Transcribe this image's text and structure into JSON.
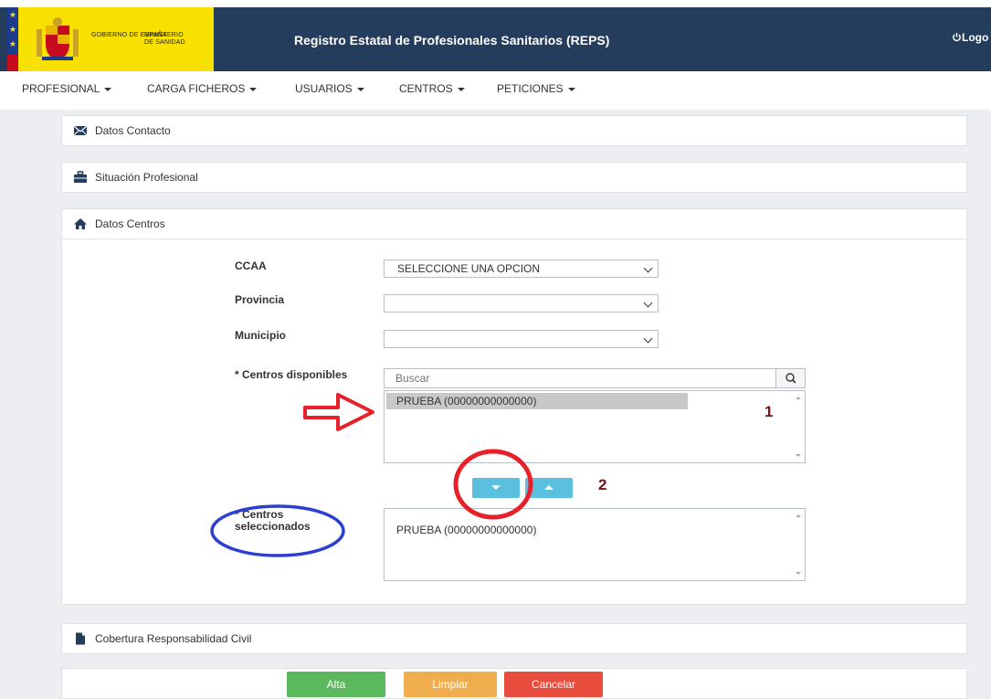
{
  "header": {
    "logo_gobierno": "GOBIERNO DE ESPAÑA",
    "logo_ministerio": "MINISTERIO DE SANIDAD",
    "title": "Registro Estatal de Profesionales Sanitarios (REPS)",
    "logout_label": "Logo"
  },
  "nav": {
    "items": [
      "PROFESIONAL",
      "CARGA FICHEROS",
      "USUARIOS",
      "CENTROS",
      "PETICIONES"
    ]
  },
  "sections": {
    "contacto": "Datos Contacto",
    "situacion": "Situación Profesional",
    "centros": "Datos Centros",
    "cobertura": "Cobertura Responsabilidad Civil"
  },
  "form": {
    "ccaa_label": "CCAA",
    "ccaa_value": "SELECCIONE UNA OPCION",
    "provincia_label": "Provincia",
    "provincia_value": "",
    "municipio_label": "Municipio",
    "municipio_value": "",
    "disponibles_label": "* Centros disponibles",
    "search_placeholder": "Buscar",
    "disponibles": [
      "PRUEBA (00000000000000)"
    ],
    "seleccionados_label": "* Centros seleccionados",
    "seleccionados": [
      "PRUEBA (00000000000000)"
    ]
  },
  "annotations": {
    "step1": "1",
    "step2": "2",
    "arrow_color": "#e8202a",
    "circle_red": "#e8202a",
    "circle_blue": "#2b3fd0"
  },
  "actions": {
    "alta": "Alta",
    "limpiar": "Limpiar",
    "cancelar": "Cancelar"
  },
  "colors": {
    "header_bg": "#243d5c",
    "logo_yellow": "#f8e000",
    "move_button": "#5bc0de",
    "alta": "#5cb85c",
    "limpiar": "#f0ad4e",
    "cancelar": "#e74c3c"
  }
}
